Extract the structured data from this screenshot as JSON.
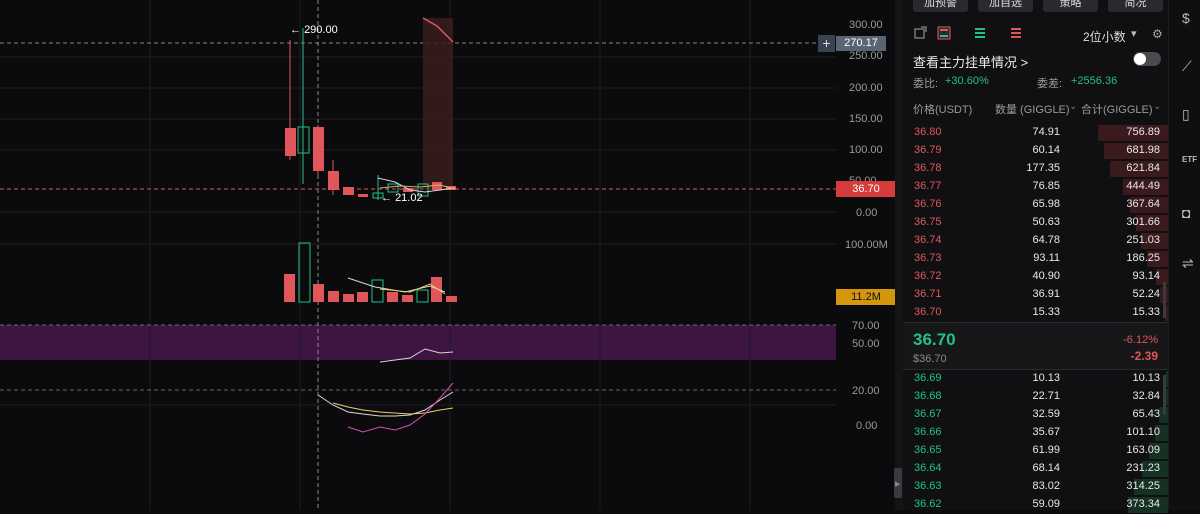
{
  "chart": {
    "price_axis": [
      "300.00",
      "250.00",
      "200.00",
      "150.00",
      "100.00",
      "50.00",
      "0.00"
    ],
    "volume_axis": [
      "100.00M"
    ],
    "rsi_axis": [
      "70.00",
      "50.00"
    ],
    "kdj_axis": [
      "20.00",
      "0.00"
    ],
    "crosshair_price": "270.17",
    "last_price": "36.70",
    "last_volume": "11.2M",
    "high_label": "290.00",
    "low_label": "21.02",
    "colors": {
      "up": "#22c08a",
      "down": "#e0565a",
      "rsi_band": "#3d1540",
      "volume_tag": "#d4960d"
    }
  },
  "panel": {
    "buttons": [
      "加预警",
      "加自选",
      "策略",
      "简况"
    ],
    "precision": "2位小数",
    "depth_link": "查看主力挂单情况 >",
    "weibi_label": "委比:",
    "weibi_value": "+30.60%",
    "weicha_label": "委差:",
    "weicha_value": "+2556.36",
    "col_price": "价格(USDT)",
    "col_qty": "数量 (GIGGLE)",
    "col_total": "合计(GIGGLE)",
    "asks": [
      {
        "price": "36.80",
        "qty": "74.91",
        "total": "756.89",
        "depth": 0.7
      },
      {
        "price": "36.79",
        "qty": "60.14",
        "total": "681.98",
        "depth": 0.64
      },
      {
        "price": "36.78",
        "qty": "177.35",
        "total": "621.84",
        "depth": 0.58
      },
      {
        "price": "36.77",
        "qty": "76.85",
        "total": "444.49",
        "depth": 0.45
      },
      {
        "price": "36.76",
        "qty": "65.98",
        "total": "367.64",
        "depth": 0.38
      },
      {
        "price": "36.75",
        "qty": "50.63",
        "total": "301.66",
        "depth": 0.32
      },
      {
        "price": "36.74",
        "qty": "64.78",
        "total": "251.03",
        "depth": 0.27
      },
      {
        "price": "36.73",
        "qty": "93.11",
        "total": "186.25",
        "depth": 0.21
      },
      {
        "price": "36.72",
        "qty": "40.90",
        "total": "93.14",
        "depth": 0.12
      },
      {
        "price": "36.71",
        "qty": "36.91",
        "total": "52.24",
        "depth": 0.08
      },
      {
        "price": "36.70",
        "qty": "15.33",
        "total": "15.33",
        "depth": 0.03
      }
    ],
    "mid_price": "36.70",
    "mid_usd": "$36.70",
    "mid_pct": "-6.12%",
    "mid_change": "-2.39",
    "bids": [
      {
        "price": "36.69",
        "qty": "10.13",
        "total": "10.13",
        "depth": 0.02
      },
      {
        "price": "36.68",
        "qty": "22.71",
        "total": "32.84",
        "depth": 0.05
      },
      {
        "price": "36.67",
        "qty": "32.59",
        "total": "65.43",
        "depth": 0.09
      },
      {
        "price": "36.66",
        "qty": "35.67",
        "total": "101.10",
        "depth": 0.13
      },
      {
        "price": "36.65",
        "qty": "61.99",
        "total": "163.09",
        "depth": 0.19
      },
      {
        "price": "36.64",
        "qty": "68.14",
        "total": "231.23",
        "depth": 0.26
      },
      {
        "price": "36.63",
        "qty": "83.02",
        "total": "314.25",
        "depth": 0.34
      },
      {
        "price": "36.62",
        "qty": "59.09",
        "total": "373.34",
        "depth": 0.4
      }
    ]
  }
}
